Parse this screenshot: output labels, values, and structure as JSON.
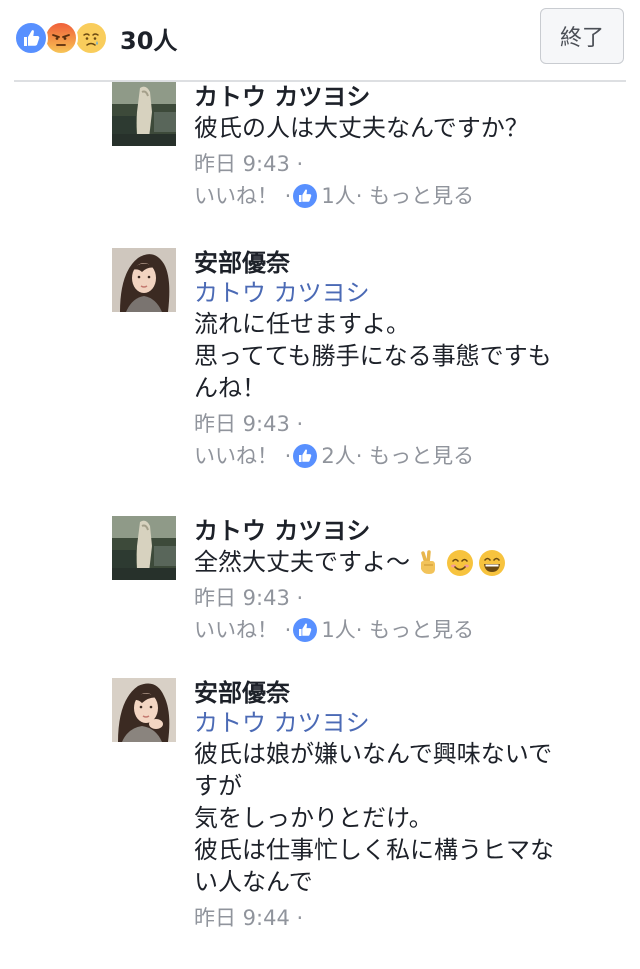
{
  "header": {
    "reaction_icons": [
      "like-icon",
      "angry-icon",
      "sad-icon"
    ],
    "reaction_count": "30人",
    "done_label": "終了"
  },
  "colors": {
    "like_blue": "#5890ff",
    "mention_blue": "#4b6ab5",
    "meta_gray": "#90949c"
  },
  "comments": [
    {
      "author": "カトウ カツヨシ",
      "mention": "",
      "lines": [
        "彼氏の人は大丈夫なんですか？"
      ],
      "time": "昨日 9:43 ·",
      "like_label": "いいね！ ·",
      "like_count": "1人",
      "more_label": "· もっと見る"
    },
    {
      "author": "安部優奈",
      "mention": "カトウ カツヨシ",
      "lines": [
        "流れに任せますよ。",
        "思ってても勝手になる事態ですも",
        "んね！"
      ],
      "time": "昨日 9:43 ·",
      "like_label": "いいね！ ·",
      "like_count": "2人",
      "more_label": "· もっと見る"
    },
    {
      "author": "カトウ カツヨシ",
      "mention": "",
      "lines": [
        "全然大丈夫ですよ〜"
      ],
      "emojis": [
        "victory-hand-icon",
        "smiling-face-icon",
        "grinning-face-icon"
      ],
      "time": "昨日 9:43 ·",
      "like_label": "いいね！ ·",
      "like_count": "1人",
      "more_label": "· もっと見る"
    },
    {
      "author": "安部優奈",
      "mention": "カトウ カツヨシ",
      "lines": [
        "彼氏は娘が嫌いなんで興味ないで",
        "すが",
        "気をしっかりとだけ。",
        "彼氏は仕事忙しく私に構うヒマな",
        "い人なんで"
      ],
      "time": "昨日 9:44 ·"
    }
  ]
}
